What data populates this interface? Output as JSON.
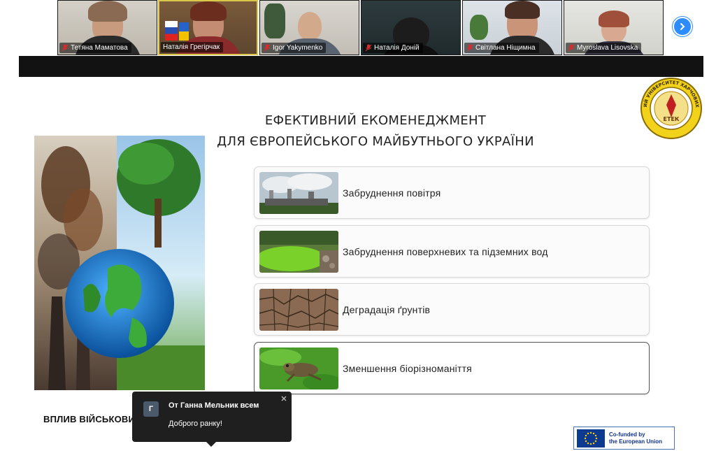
{
  "participants": [
    {
      "name": "Тетяна Маматова",
      "muted": true
    },
    {
      "name": "Наталія Грегірчак",
      "muted": true
    },
    {
      "name": "Igor Yakymenko",
      "muted": true
    },
    {
      "name": "Наталія Доній",
      "muted": true
    },
    {
      "name": "Світлана Ніщимна",
      "muted": true
    },
    {
      "name": "Myroslava Lisovska",
      "muted": true
    }
  ],
  "slide": {
    "title_line1": "ЕФЕКТИВНИЙ ЕКОМЕНЕДЖМЕНТ",
    "title_line2": "ДЛЯ ЄВРОПЕЙСЬКОГО МАЙБУТНЬОГО УКРАЇНИ",
    "seal_text": "НАЦІОНАЛЬНИЙ УНІВЕРСИТЕТ ХАРЧОВИХ ТЕХНОЛОГІЙ",
    "seal_center": "ЕТЕК",
    "items": [
      {
        "label": "Забруднення повітря",
        "thumb": "factory-smoke"
      },
      {
        "label": "Забруднення поверхневих та підземних вод",
        "thumb": "green-water"
      },
      {
        "label": "Деградація ґрунтів",
        "thumb": "cracked-soil"
      },
      {
        "label": "Зменшення біорізноманіття",
        "thumb": "frog"
      }
    ],
    "bottom_text": "ВПЛИВ ВІЙСЬКОВИ",
    "eu_line1": "Co-funded by",
    "eu_line2": "the European Union"
  },
  "chat": {
    "avatar_letter": "Г",
    "from": "От Ганна Мельник всем",
    "message": "Доброго ранку!"
  },
  "colors": {
    "accent": "#2d8cff",
    "mute_red": "#e02828",
    "active_speaker": "#d9c84a",
    "eu_blue": "#0d3a91"
  }
}
